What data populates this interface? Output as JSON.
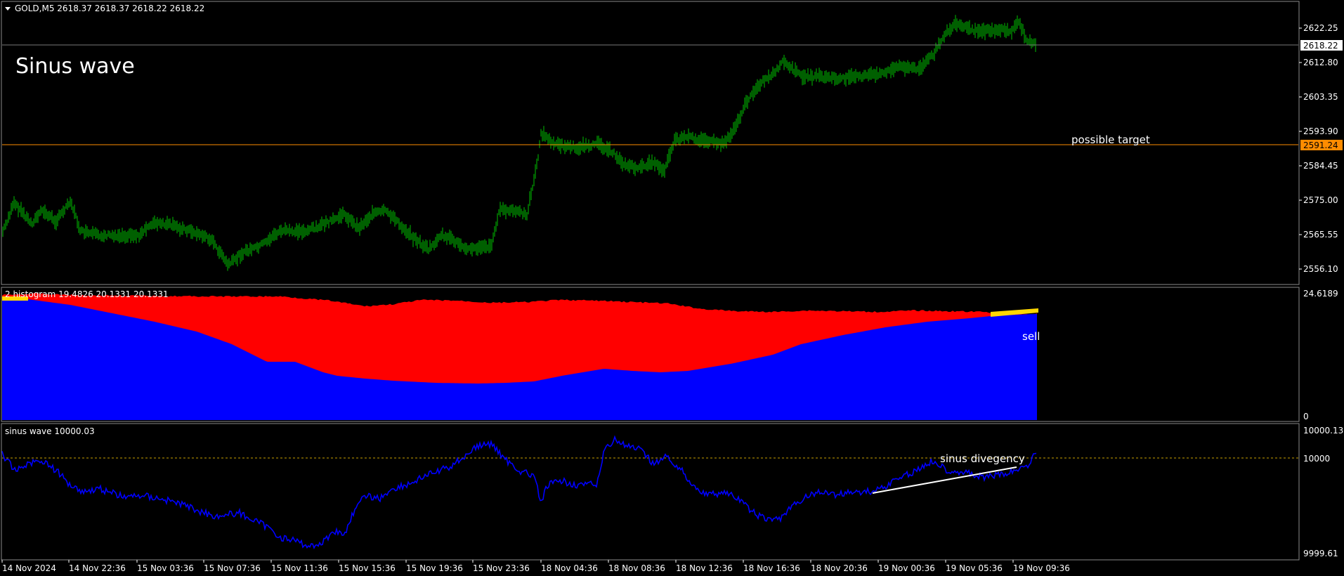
{
  "main_panel": {
    "symbol_header": "GOLD,M5  2618.37 2618.37 2618.22 2618.22",
    "chart_title": "Sinus wave",
    "price_ticks": [
      "2622.25",
      "2612.80",
      "2603.35",
      "2593.90",
      "2584.45",
      "2575.00",
      "2565.55",
      "2556.10"
    ],
    "current_price": "2618.22",
    "target_price": "2591.24",
    "target_note": "possible target",
    "colors": {
      "price": "#00c000",
      "target_line": "#ff8c00",
      "current_line": "#808080",
      "current_badge": "#ffffff"
    }
  },
  "histogram_panel": {
    "header": "2 histogram 19.4826 20.1331 20.1331",
    "ticks": [
      "24.6189",
      "0"
    ],
    "signal_label": "sell",
    "colors": {
      "bull": "#0000ff",
      "bear": "#ff0000",
      "signal": "#ffd700"
    }
  },
  "sine_panel": {
    "header": "sinus wave 10000.03",
    "ticks": [
      "10000.13",
      "10000",
      "9999.61"
    ],
    "annotation": "sinus divegency",
    "colors": {
      "line": "#0000ff",
      "level": "#c8a000",
      "divergence": "#ffffff"
    }
  },
  "time_axis": {
    "labels": [
      "14 Nov 2024",
      "14 Nov 22:36",
      "15 Nov 03:36",
      "15 Nov 07:36",
      "15 Nov 11:36",
      "15 Nov 15:36",
      "15 Nov 19:36",
      "15 Nov 23:36",
      "18 Nov 04:36",
      "18 Nov 08:36",
      "18 Nov 12:36",
      "18 Nov 16:36",
      "18 Nov 20:36",
      "19 Nov 00:36",
      "19 Nov 05:36",
      "19 Nov 09:36"
    ]
  }
}
